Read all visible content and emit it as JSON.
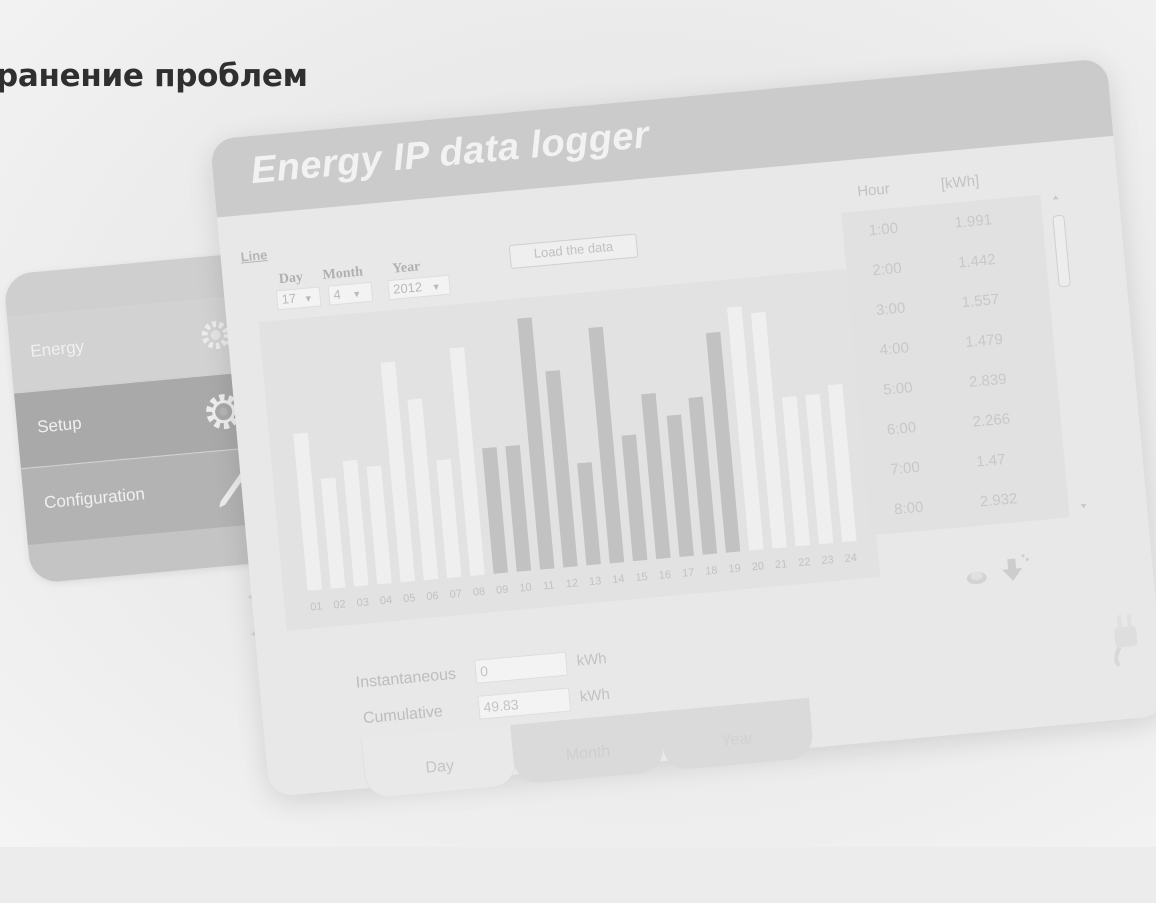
{
  "page_heading": "ранение проблем",
  "app_title": "Energy IP data logger",
  "sidebar": {
    "items": [
      {
        "label": "Energy",
        "icon": "energy-gear-icon"
      },
      {
        "label": "Setup",
        "icon": "gear-icon"
      },
      {
        "label": "Configuration",
        "icon": "pencil-icon"
      }
    ]
  },
  "controls": {
    "line_link": "Line",
    "day_label": "Day",
    "month_label": "Month",
    "year_label": "Year",
    "day_value": "17",
    "month_value": "4",
    "year_value": "2012",
    "load_button": "Load the data"
  },
  "chart_data": {
    "type": "bar",
    "categories": [
      "01",
      "02",
      "03",
      "04",
      "05",
      "06",
      "07",
      "08",
      "09",
      "10",
      "11",
      "12",
      "13",
      "14",
      "15",
      "16",
      "17",
      "18",
      "19",
      "20",
      "21",
      "22",
      "23",
      "24"
    ],
    "values": [
      2.0,
      1.4,
      1.6,
      1.5,
      2.8,
      2.3,
      1.5,
      2.9,
      1.6,
      1.6,
      3.2,
      2.5,
      1.3,
      3.0,
      1.6,
      2.1,
      1.8,
      2.0,
      2.8,
      3.1,
      3.0,
      1.9,
      1.9,
      2.0
    ],
    "highlight_hours": [
      "09",
      "10",
      "11",
      "12",
      "13",
      "14",
      "15",
      "16",
      "17",
      "18",
      "19"
    ]
  },
  "hour_table": {
    "header_hour": "Hour",
    "header_kwh": "[kWh]",
    "rows": [
      {
        "hour": "1:00",
        "kwh": "1.991"
      },
      {
        "hour": "2:00",
        "kwh": "1.442"
      },
      {
        "hour": "3:00",
        "kwh": "1.557"
      },
      {
        "hour": "4:00",
        "kwh": "1.479"
      },
      {
        "hour": "5:00",
        "kwh": "2.839"
      },
      {
        "hour": "6:00",
        "kwh": "2.266"
      },
      {
        "hour": "7:00",
        "kwh": "1.47"
      },
      {
        "hour": "8:00",
        "kwh": "2.932"
      }
    ]
  },
  "measurements": {
    "instantaneous_label": "Instantaneous",
    "instantaneous_value": "0",
    "instantaneous_unit": "kWh",
    "cumulative_label": "Cumulative",
    "cumulative_value": "49.83",
    "cumulative_unit": "kWh"
  },
  "tabs": [
    "Day",
    "Month",
    "Year"
  ]
}
